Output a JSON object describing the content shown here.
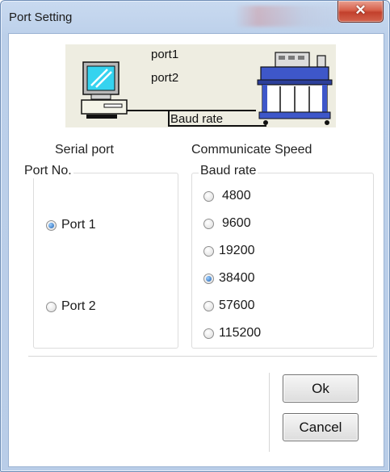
{
  "window": {
    "title": "Port Setting"
  },
  "diagram": {
    "port1_label": "port1",
    "port2_label": "port2",
    "baud_label": "Baud rate"
  },
  "serial_port": {
    "heading": "Serial port",
    "group_title": "Port No.",
    "options": [
      {
        "label": "Port 1",
        "checked": true
      },
      {
        "label": "Port 2",
        "checked": false
      }
    ]
  },
  "speed": {
    "heading": "Communicate Speed",
    "group_title": "Baud rate",
    "options": [
      {
        "label": "4800",
        "checked": false
      },
      {
        "label": "9600",
        "checked": false
      },
      {
        "label": "19200",
        "checked": false
      },
      {
        "label": "38400",
        "checked": true
      },
      {
        "label": "57600",
        "checked": false
      },
      {
        "label": "115200",
        "checked": false
      }
    ]
  },
  "buttons": {
    "ok": "Ok",
    "cancel": "Cancel"
  },
  "icons": {
    "close": "close-icon",
    "computer": "computer-icon",
    "printer": "plotter-icon"
  },
  "colors": {
    "close_button": "#d35a45",
    "diagram_bg": "#eeede1",
    "radio_selected": "#1b5fb0"
  }
}
